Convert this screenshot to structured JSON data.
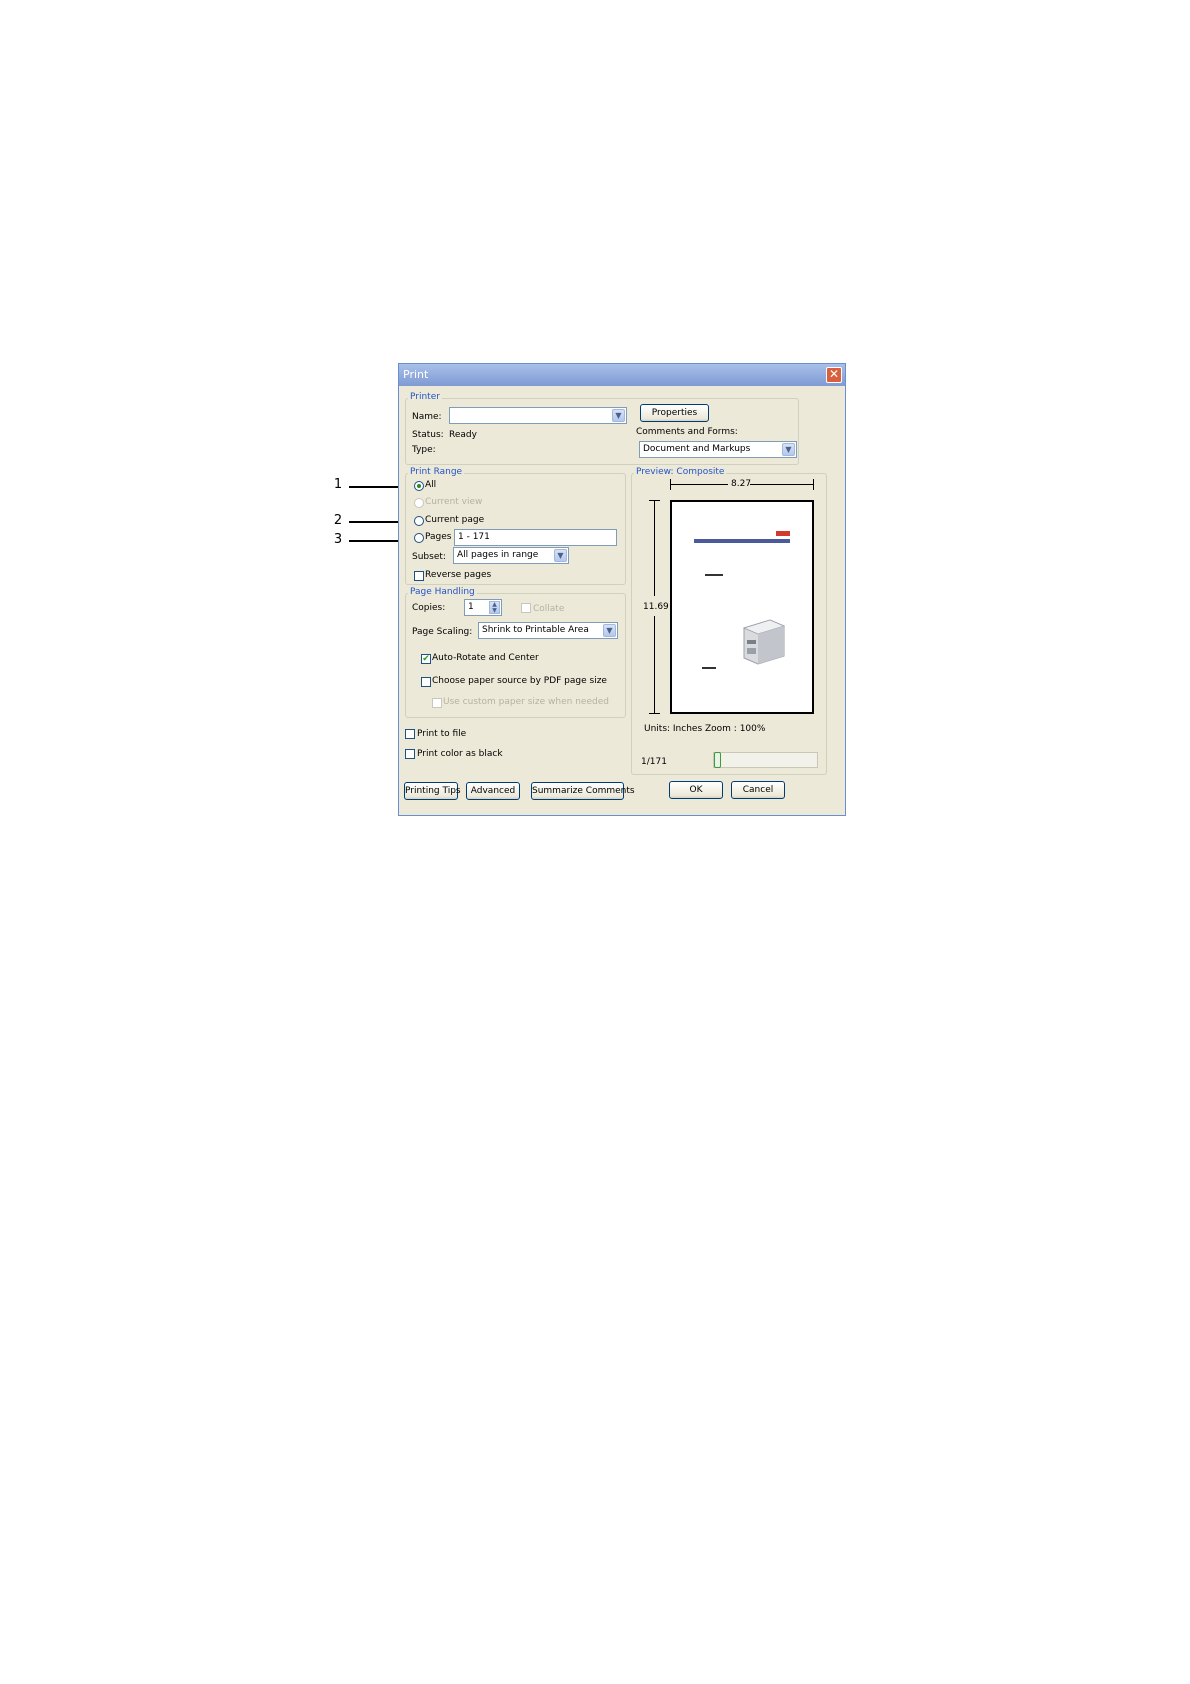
{
  "callouts": {
    "one": "1",
    "two": "2",
    "three": "3"
  },
  "dialog": {
    "title": "Print",
    "close_glyph": "✕",
    "printer": {
      "legend": "Printer",
      "name_label": "Name:",
      "name_value": "",
      "status_label": "Status:",
      "status_value": "Ready",
      "type_label": "Type:",
      "type_value": "",
      "properties_button": "Properties",
      "comments_label": "Comments and Forms:",
      "comments_value": "Document and Markups"
    },
    "print_range": {
      "legend": "Print Range",
      "all": "All",
      "current_view": "Current view",
      "current_page": "Current page",
      "pages": "Pages",
      "pages_value": "1 - 171",
      "subset_label": "Subset:",
      "subset_value": "All pages in range",
      "reverse_pages": "Reverse pages"
    },
    "page_handling": {
      "legend": "Page Handling",
      "copies_label": "Copies:",
      "copies_value": "1",
      "collate": "Collate",
      "scaling_label": "Page Scaling:",
      "scaling_value": "Shrink to Printable Area",
      "auto_rotate": "Auto-Rotate and Center",
      "choose_paper": "Choose paper source by PDF page size",
      "custom_paper": "Use custom paper size when needed"
    },
    "print_to_file": "Print to file",
    "print_color_black": "Print color as black",
    "preview": {
      "legend": "Preview: Composite",
      "width": "8.27",
      "height": "11.69",
      "units": "Units: Inches Zoom : 100%",
      "page_counter": "1/171",
      "slider_position": 0.0
    },
    "buttons": {
      "printing_tips": "Printing Tips",
      "advanced": "Advanced",
      "summarize": "Summarize Comments",
      "ok": "OK",
      "cancel": "Cancel"
    },
    "colors": {
      "accent": "#2354c8",
      "titlebar": "#8fa9dc",
      "dialog_bg": "#ece9d8"
    }
  }
}
